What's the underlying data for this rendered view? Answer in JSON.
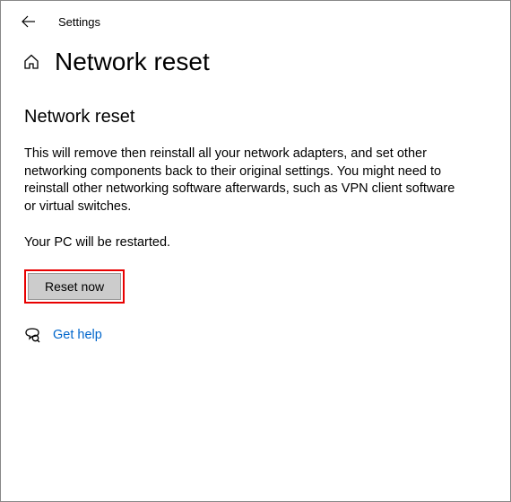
{
  "header": {
    "settings_label": "Settings"
  },
  "page": {
    "title": "Network reset",
    "section_heading": "Network reset",
    "body_text": "This will remove then reinstall all your network adapters, and set other networking components back to their original settings. You might need to reinstall other networking software afterwards, such as VPN client software or virtual switches.",
    "restart_text": "Your PC will be restarted.",
    "reset_button_label": "Reset now",
    "help_link_label": "Get help"
  }
}
